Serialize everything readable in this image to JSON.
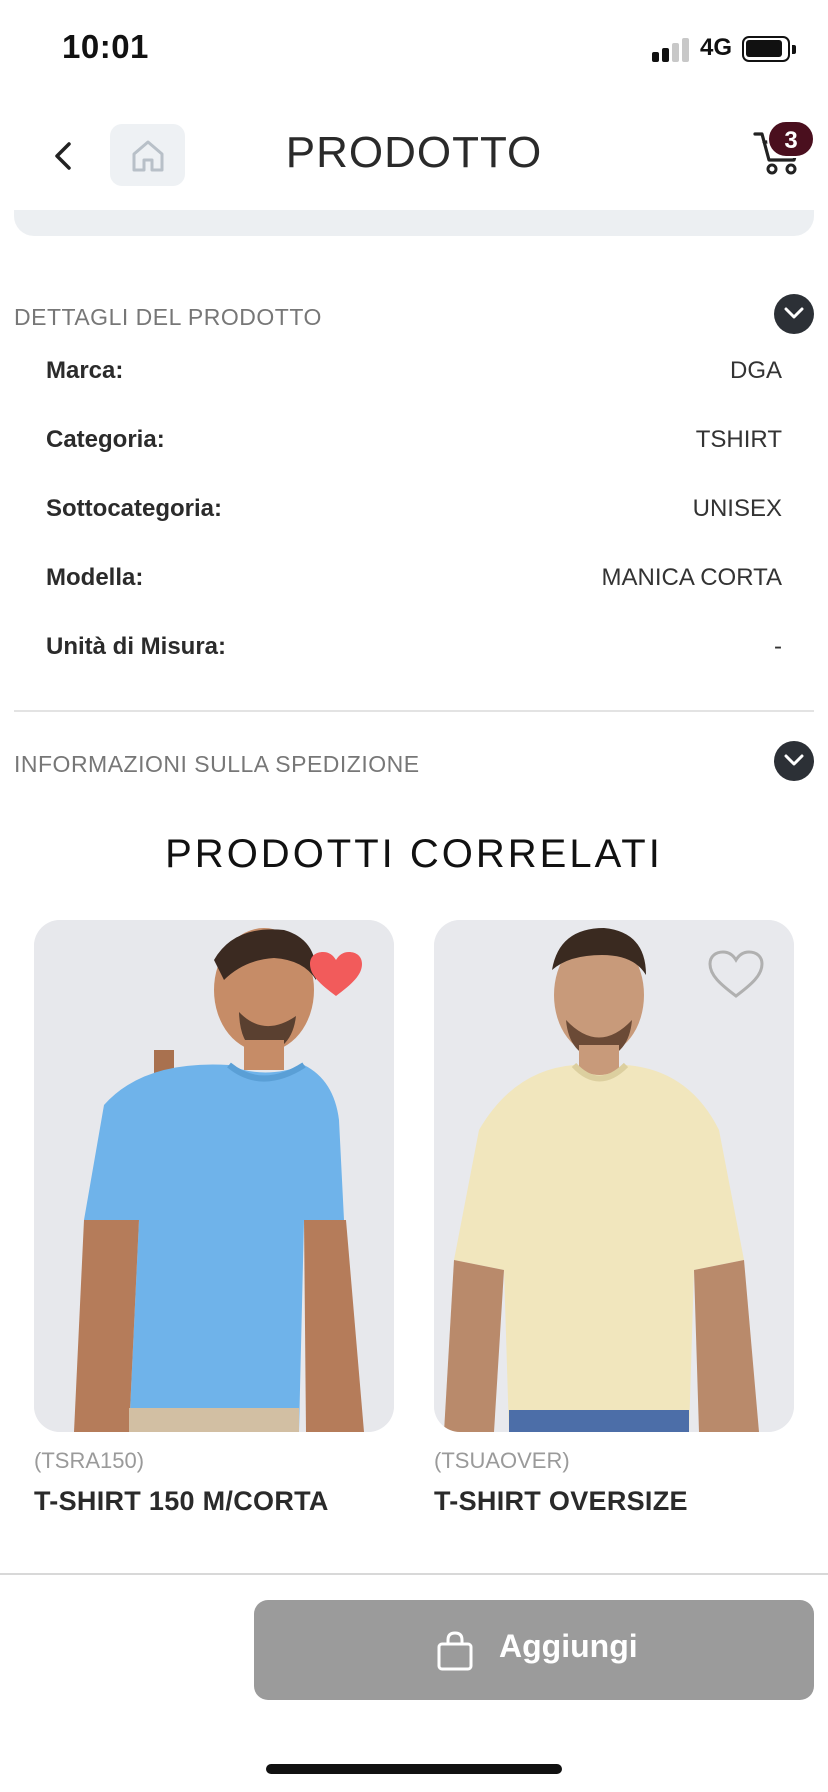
{
  "status": {
    "time": "10:01",
    "network": "4G"
  },
  "header": {
    "title": "PRODOTTO",
    "cart_count": "3"
  },
  "details": {
    "label": "DETTAGLI DEL PRODOTTO",
    "rows": [
      {
        "key": "Marca:",
        "value": "DGA"
      },
      {
        "key": "Categoria:",
        "value": "TSHIRT"
      },
      {
        "key": "Sottocategoria:",
        "value": "UNISEX"
      },
      {
        "key": "Modella:",
        "value": "MANICA CORTA"
      },
      {
        "key": "Unità di Misura:",
        "value": "-"
      }
    ]
  },
  "shipping": {
    "label": "INFORMAZIONI SULLA SPEDIZIONE"
  },
  "related": {
    "title": "PRODOTTI CORRELATI",
    "products": [
      {
        "code": "(TSRA150)",
        "name": "T-SHIRT 150 M/CORTA",
        "favorite": true,
        "shirt_color": "#6fb3ea"
      },
      {
        "code": "(TSUAOVER)",
        "name": "T-SHIRT OVERSIZE",
        "favorite": false,
        "shirt_color": "#f1e6bd"
      }
    ]
  },
  "actions": {
    "add_label": "Aggiungi"
  },
  "colors": {
    "badge": "#4a0f1e",
    "favorite": "#f25b5b",
    "button": "#9b9b9b"
  }
}
